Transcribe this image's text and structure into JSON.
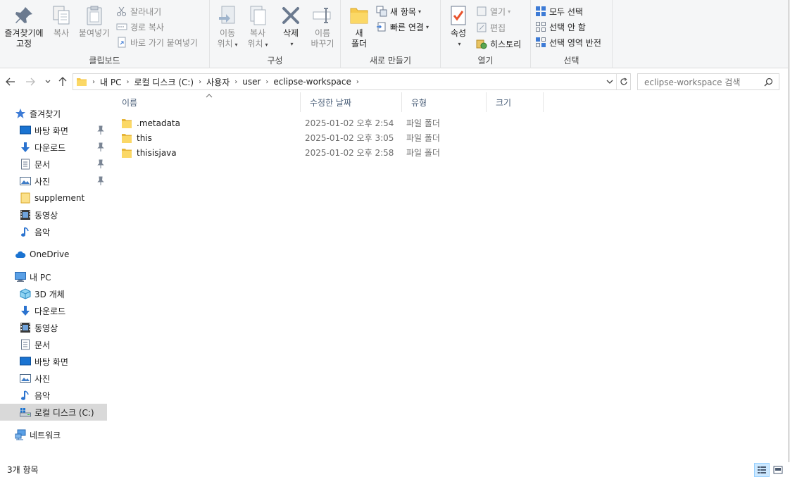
{
  "ribbon": {
    "clipboard": {
      "label": "클립보드",
      "pin": "즐겨찾기에 고정",
      "pin_line1": "즐겨찾기에",
      "pin_line2": "고정",
      "copy": "복사",
      "paste": "붙여넣기",
      "cut": "잘라내기",
      "copy_path": "경로 복사",
      "paste_shortcut": "바로 가기 붙여넣기"
    },
    "organize": {
      "label": "구성",
      "move_to_1": "이동",
      "move_to_2": "위치",
      "copy_to_1": "복사",
      "copy_to_2": "위치",
      "delete": "삭제",
      "rename_1": "이름",
      "rename_2": "바꾸기"
    },
    "new": {
      "label": "새로 만들기",
      "new_folder_1": "새",
      "new_folder_2": "폴더",
      "new_item": "새 항목",
      "easy_access": "빠른 연결"
    },
    "open": {
      "label": "열기",
      "properties": "속성",
      "open": "열기",
      "edit": "편집",
      "history": "히스토리"
    },
    "select": {
      "label": "선택",
      "select_all": "모두 선택",
      "select_none": "선택 안 함",
      "invert": "선택 영역 반전"
    }
  },
  "address": {
    "crumbs": [
      "내 PC",
      "로컬 디스크 (C:)",
      "사용자",
      "user",
      "eclipse-workspace"
    ],
    "search_placeholder": "eclipse-workspace 검색"
  },
  "navpane": {
    "quick_access": "즐겨찾기",
    "quick_items": [
      "바탕 화면",
      "다운로드",
      "문서",
      "사진",
      "supplement",
      "동영상",
      "음악"
    ],
    "onedrive": "OneDrive",
    "this_pc": "내 PC",
    "pc_items": [
      "3D 개체",
      "다운로드",
      "동영상",
      "문서",
      "바탕 화면",
      "사진",
      "음악",
      "로컬 디스크 (C:)"
    ],
    "network": "네트워크"
  },
  "columns": {
    "name": "이름",
    "modified": "수정한 날짜",
    "type": "유형",
    "size": "크기"
  },
  "files": [
    {
      "name": ".metadata",
      "modified": "2025-01-02 오후 2:54",
      "type": "파일 폴더"
    },
    {
      "name": "this",
      "modified": "2025-01-02 오후 3:05",
      "type": "파일 폴더"
    },
    {
      "name": "thisisjava",
      "modified": "2025-01-02 오후 2:58",
      "type": "파일 폴더"
    }
  ],
  "status": {
    "item_count": "3개 항목"
  },
  "colors": {
    "folder": "#f6c94c",
    "accent": "#0078d7",
    "header_text": "#4c607a"
  }
}
